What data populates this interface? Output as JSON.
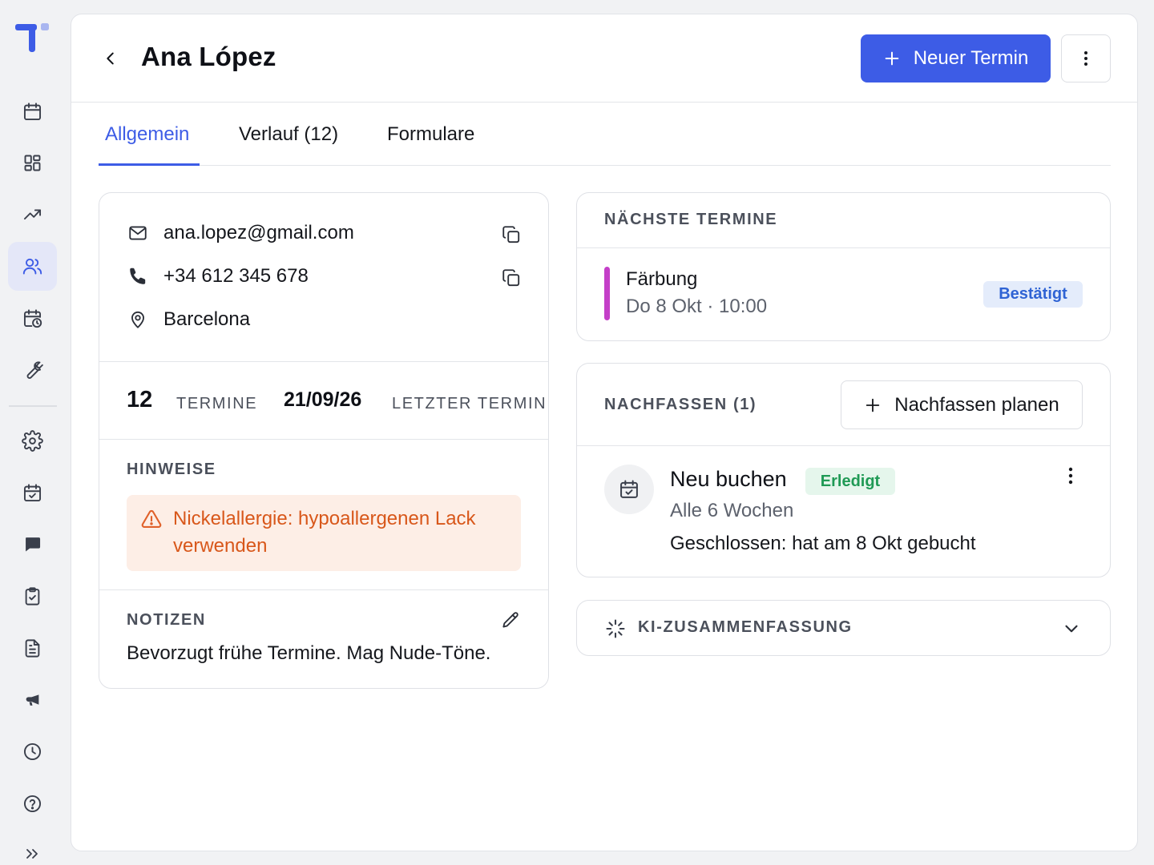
{
  "sidebar": {
    "items": [
      {
        "icon": "calendar-icon"
      },
      {
        "icon": "dashboard-icon"
      },
      {
        "icon": "trending-up-icon"
      },
      {
        "icon": "users-icon",
        "active": true
      },
      {
        "icon": "calendar-clock-icon"
      },
      {
        "icon": "wrench-icon"
      },
      {
        "icon": "gear-icon"
      },
      {
        "icon": "calendar-check-icon"
      },
      {
        "icon": "chat-icon"
      },
      {
        "icon": "clipboard-check-icon"
      },
      {
        "icon": "document-icon"
      },
      {
        "icon": "megaphone-icon"
      },
      {
        "icon": "clock-icon"
      },
      {
        "icon": "help-icon"
      }
    ],
    "expand_icon": "chevrons-right-icon"
  },
  "header": {
    "title": "Ana López",
    "primary_button": "Neuer Termin",
    "accent_color": "#3d5ce6"
  },
  "tabs": [
    {
      "label": "Allgemein",
      "active": true
    },
    {
      "label": "Verlauf (12)"
    },
    {
      "label": "Formulare"
    }
  ],
  "contact": {
    "email": "ana.lopez@gmail.com",
    "phone": "+34 612 345 678",
    "city": "Barcelona"
  },
  "stats": {
    "appointments_count": "12",
    "appointments_label": "TERMINE",
    "last_date": "21/09/26",
    "last_label": "LETZTER TERMIN"
  },
  "hints": {
    "label": "HINWEISE",
    "alert": "Nickelallergie: hypoallergenen Lack verwenden",
    "alert_color": "#d8571a"
  },
  "notes": {
    "label": "NOTIZEN",
    "text": "Bevorzugt frühe Termine. Mag Nude-Töne."
  },
  "upcoming": {
    "label": "NÄCHSTE TERMINE",
    "appointment": {
      "title": "Färbung",
      "time": "Do 8 Okt · 10:00",
      "status": "Bestätigt",
      "color": "#c43fc8"
    }
  },
  "followup": {
    "label": "NACHFASSEN (1)",
    "button": "Nachfassen planen",
    "item": {
      "title": "Neu buchen",
      "status": "Erledigt",
      "interval": "Alle 6 Wochen",
      "note": "Geschlossen: hat am 8 Okt gebucht"
    }
  },
  "ai_summary": {
    "label": "KI-ZUSAMMENFASSUNG"
  }
}
